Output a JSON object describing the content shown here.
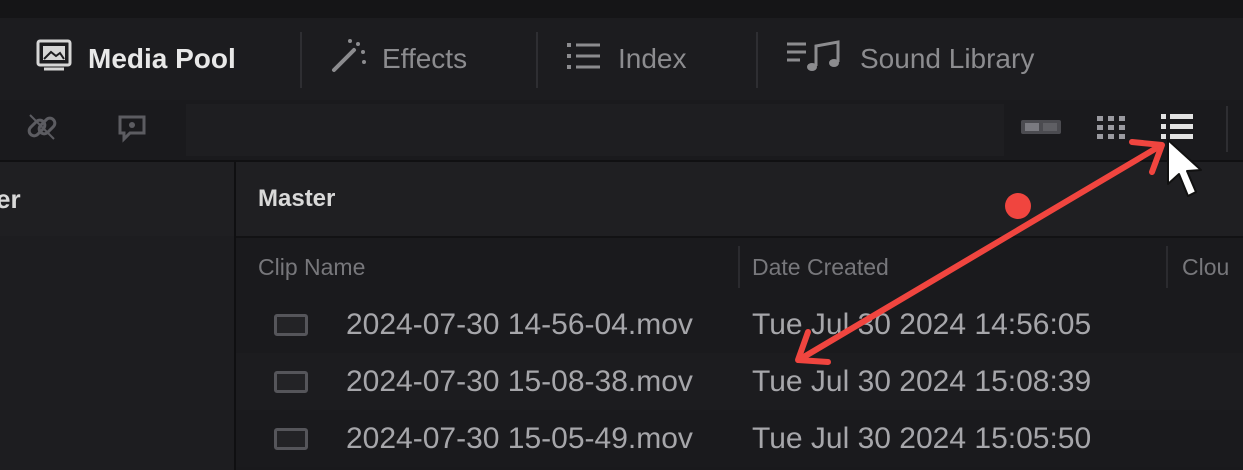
{
  "tabs": [
    {
      "label": "Media Pool",
      "icon": "media-pool-icon",
      "active": true
    },
    {
      "label": "Effects",
      "icon": "effects-wand-icon",
      "active": false
    },
    {
      "label": "Index",
      "icon": "index-list-icon",
      "active": false
    },
    {
      "label": "Sound Library",
      "icon": "sound-library-icon",
      "active": false
    }
  ],
  "toolbar": {
    "left_icons": [
      "link-icon",
      "speech-bubble-icon"
    ],
    "view_icons": [
      "thumbnail-view-icon",
      "grid-view-icon",
      "list-view-icon"
    ]
  },
  "sidebar": {
    "title": "er"
  },
  "main": {
    "title": "Master",
    "columns": [
      "Clip Name",
      "Date Created",
      "Clou"
    ],
    "rows": [
      {
        "clip_name": "2024-07-30 14-56-04.mov",
        "date_created": "Tue Jul 30 2024 14:56:05"
      },
      {
        "clip_name": "2024-07-30 15-08-38.mov",
        "date_created": "Tue Jul 30 2024 15:08:39"
      },
      {
        "clip_name": "2024-07-30 15-05-49.mov",
        "date_created": "Tue Jul 30 2024 15:05:50"
      }
    ]
  },
  "annotation": {
    "color": "#f0453f",
    "type": "double-headed-arrow"
  },
  "colors": {
    "background": "#151517",
    "text_active": "#e8e8e8",
    "text_muted": "#8c8c8f"
  }
}
